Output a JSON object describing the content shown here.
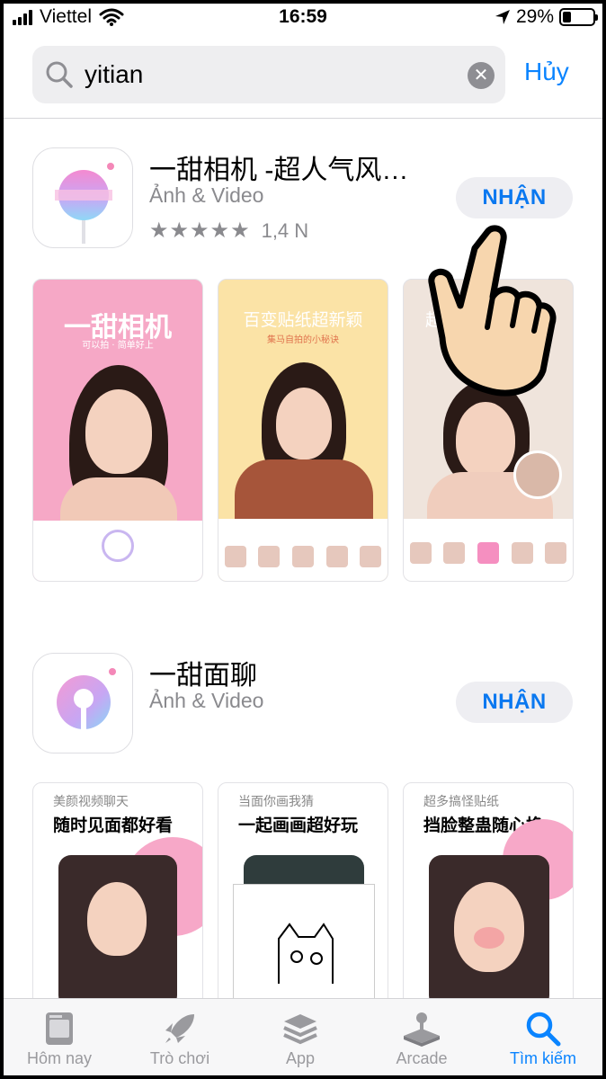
{
  "status": {
    "carrier": "Viettel",
    "time": "16:59",
    "battery": "29%",
    "battery_level": 0.29
  },
  "search": {
    "query": "yitian",
    "cancel_label": "Hủy"
  },
  "results": [
    {
      "title": "一甜相机 -超人气风…",
      "category": "Ảnh & Video",
      "stars": "★★★★★",
      "rating_count": "1,4 N",
      "get_label": "NHẬN",
      "shots": [
        {
          "headline": "一甜相机",
          "sub": "可以拍 · 简单好上"
        },
        {
          "headline": "百变贴纸超新颖",
          "sub": "集马自拍的小秘诀"
        },
        {
          "headline": "超",
          "sub": ""
        }
      ]
    },
    {
      "title": "一甜面聊",
      "category": "Ảnh & Video",
      "get_label": "NHẬN",
      "shots": [
        {
          "small": "美颜视频聊天",
          "headline": "随时见面都好看"
        },
        {
          "small": "当面你画我猜",
          "headline": "一起画画超好玩"
        },
        {
          "small": "超多搞怪贴纸",
          "headline": "挡脸整蛊随心换"
        }
      ]
    }
  ],
  "tabbar": [
    {
      "label": "Hôm nay",
      "icon": "today-icon"
    },
    {
      "label": "Trò chơi",
      "icon": "rocket-icon"
    },
    {
      "label": "App",
      "icon": "layers-icon"
    },
    {
      "label": "Arcade",
      "icon": "joystick-icon"
    },
    {
      "label": "Tìm kiếm",
      "icon": "search-icon"
    }
  ],
  "colors": {
    "accent": "#0a84ff",
    "button_text": "#0a78f0",
    "shot_pink": "#f7a8c8",
    "shot_yellow": "#fbe3a6"
  }
}
